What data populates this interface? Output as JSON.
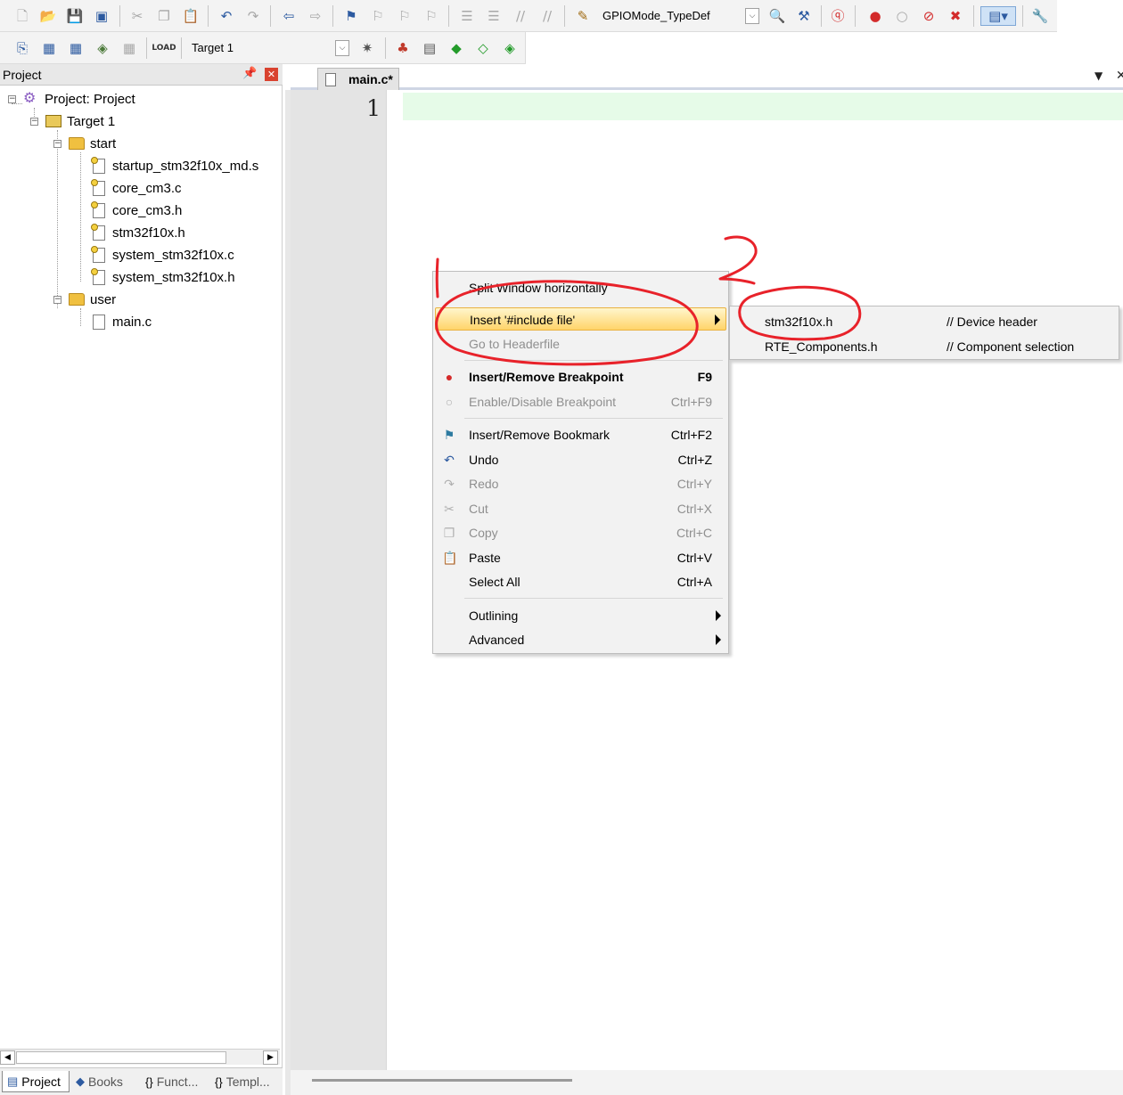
{
  "toolbar": {
    "function_combo_value": "GPIOMode_TypeDef",
    "target_combo_value": "Target 1"
  },
  "project_panel": {
    "title": "Project",
    "tree": {
      "project_label": "Project: Project",
      "target_label": "Target 1",
      "groups": [
        {
          "label": "start",
          "files": [
            "startup_stm32f10x_md.s",
            "core_cm3.c",
            "core_cm3.h",
            "stm32f10x.h",
            "system_stm32f10x.c",
            "system_stm32f10x.h"
          ]
        },
        {
          "label": "user",
          "files": [
            "main.c"
          ]
        }
      ]
    },
    "bottom_tabs": [
      "Project",
      "Books",
      "Funct...",
      "Templ..."
    ]
  },
  "editor": {
    "tab_label": "main.c*",
    "line_numbers": [
      "1"
    ]
  },
  "context_menu": {
    "items": [
      {
        "label": "Split Window horizontally",
        "shortcut": ""
      },
      {
        "label": "Insert '#include file'",
        "shortcut": ""
      },
      {
        "label": "Go to Headerfile",
        "shortcut": ""
      },
      {
        "label": "Insert/Remove Breakpoint",
        "shortcut": "F9"
      },
      {
        "label": "Enable/Disable Breakpoint",
        "shortcut": "Ctrl+F9"
      },
      {
        "label": "Insert/Remove Bookmark",
        "shortcut": "Ctrl+F2"
      },
      {
        "label": "Undo",
        "shortcut": "Ctrl+Z"
      },
      {
        "label": "Redo",
        "shortcut": "Ctrl+Y"
      },
      {
        "label": "Cut",
        "shortcut": "Ctrl+X"
      },
      {
        "label": "Copy",
        "shortcut": "Ctrl+C"
      },
      {
        "label": "Paste",
        "shortcut": "Ctrl+V"
      },
      {
        "label": "Select All",
        "shortcut": "Ctrl+A"
      },
      {
        "label": "Outlining",
        "shortcut": ""
      },
      {
        "label": "Advanced",
        "shortcut": ""
      }
    ]
  },
  "submenu": {
    "items": [
      {
        "file": "stm32f10x.h",
        "comment": "// Device header"
      },
      {
        "file": "RTE_Components.h",
        "comment": "// Component selection"
      }
    ]
  },
  "annotations": {
    "marks": [
      "1",
      "2"
    ],
    "color": "#e8222a"
  }
}
